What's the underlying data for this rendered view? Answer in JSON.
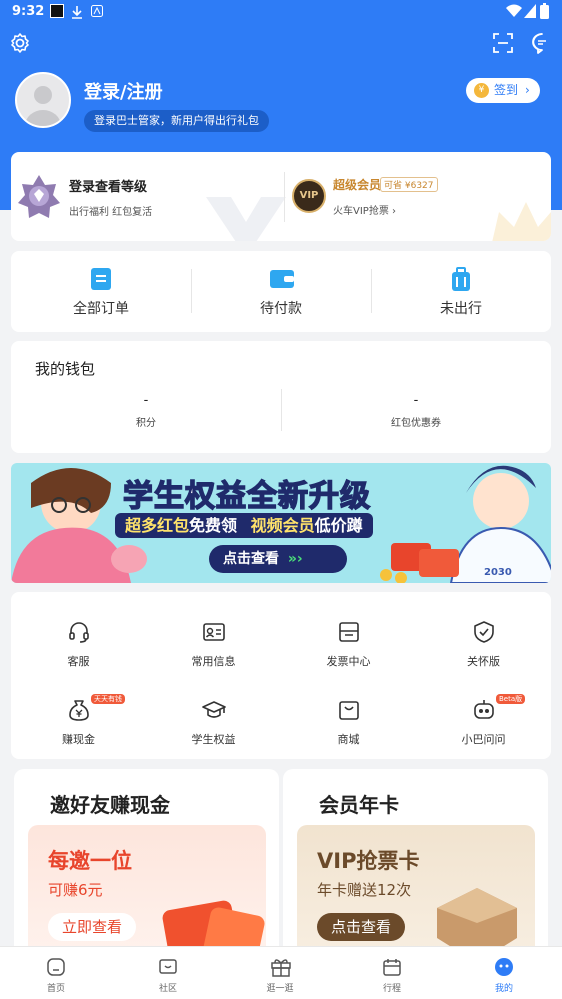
{
  "status_bar": {
    "time": "9:32"
  },
  "profile": {
    "login_title": "登录/注册",
    "login_tip": "登录巴士管家，新用户得出行礼包",
    "signin_label": "签到",
    "signin_coin": "¥"
  },
  "level_card": {
    "title": "登录查看等级",
    "subtitle": "出行福利  红包复活",
    "vip_title": "超级会员",
    "vip_save": "可省 ¥6327",
    "vip_sub": "火车VIP抢票 ›",
    "vip_badge": "VIP"
  },
  "orders": [
    {
      "label": "全部订单",
      "icon": "document-icon"
    },
    {
      "label": "待付款",
      "icon": "wallet-icon"
    },
    {
      "label": "未出行",
      "icon": "suitcase-icon"
    }
  ],
  "wallet": {
    "title": "我的钱包",
    "items": [
      {
        "value": "-",
        "label": "积分"
      },
      {
        "value": "-",
        "label": "红包优惠券"
      }
    ]
  },
  "banner": {
    "title_a": "学生权益",
    "title_b": "全新升级",
    "subtitle_a": "超多红包",
    "subtitle_b": "免费领",
    "subtitle_c": "视频会员",
    "subtitle_d": "低价蹲",
    "button": "点击查看",
    "jersey": "2030"
  },
  "services": [
    {
      "label": "客服",
      "icon": "headset-icon"
    },
    {
      "label": "常用信息",
      "icon": "id-card-icon"
    },
    {
      "label": "发票中心",
      "icon": "invoice-icon"
    },
    {
      "label": "关怀版",
      "icon": "heart-shield-icon"
    },
    {
      "label": "赚现金",
      "icon": "money-bag-icon",
      "tag": "天天有钱"
    },
    {
      "label": "学生权益",
      "icon": "graduation-cap-icon"
    },
    {
      "label": "商城",
      "icon": "shopping-bag-icon"
    },
    {
      "label": "小巴问问",
      "icon": "robot-icon",
      "tag": "Beta版"
    }
  ],
  "promos": [
    {
      "heading": "邀好友赚现金",
      "big": "每邀一位",
      "small": "可赚6元",
      "button": "立即查看"
    },
    {
      "heading": "会员年卡",
      "big": "VIP抢票卡",
      "small": "年卡赠送12次",
      "button": "点击查看"
    }
  ],
  "tabbar": [
    {
      "label": "首页",
      "icon": "home-icon"
    },
    {
      "label": "社区",
      "icon": "community-icon"
    },
    {
      "label": "逛一逛",
      "icon": "gift-icon"
    },
    {
      "label": "行程",
      "icon": "calendar-icon"
    },
    {
      "label": "我的",
      "icon": "profile-face-icon",
      "active": true
    }
  ],
  "colors": {
    "brand_blue": "#2e7cf6",
    "gold": "#c8872f",
    "red": "#e8452c"
  }
}
